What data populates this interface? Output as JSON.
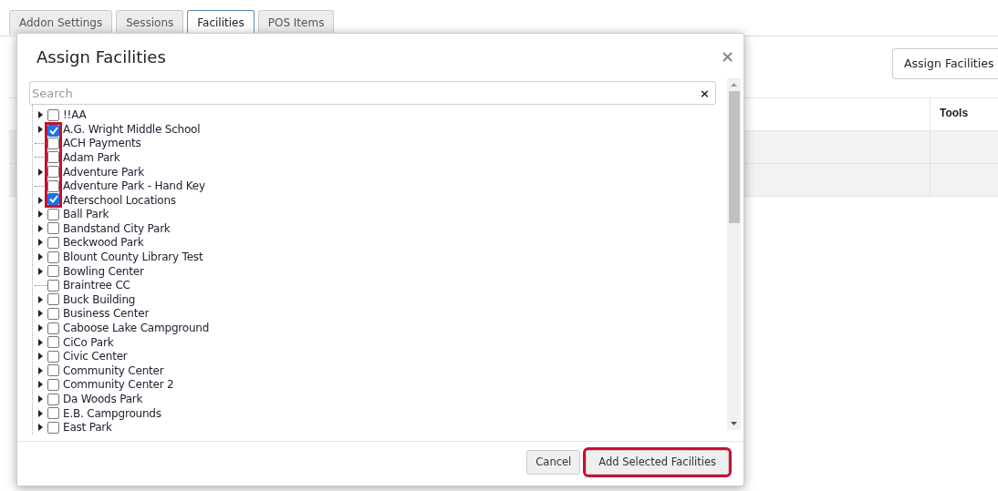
{
  "tabs": [
    {
      "label": "Addon Settings",
      "selected": false
    },
    {
      "label": "Sessions",
      "selected": false
    },
    {
      "label": "Facilities",
      "selected": true
    },
    {
      "label": "POS Items",
      "selected": false
    }
  ],
  "page": {
    "button": "Assign Facilities",
    "table": {
      "columns": [
        "Tools"
      ],
      "row_count_rows": [
        {
          "kind": "empty"
        },
        {
          "kind": "empty"
        }
      ]
    }
  },
  "dialog": {
    "title": "Assign Facilities",
    "close": "×",
    "search": {
      "placeholder": "Search",
      "clear": "×"
    },
    "items": [
      {
        "label": "!!AA",
        "expandable": true,
        "checked": false,
        "highlighted": false
      },
      {
        "label": "A.G. Wright Middle School",
        "expandable": true,
        "checked": true,
        "highlighted": true
      },
      {
        "label": "ACH Payments",
        "expandable": false,
        "checked": false,
        "highlighted": true
      },
      {
        "label": "Adam Park",
        "expandable": false,
        "checked": false,
        "highlighted": true
      },
      {
        "label": "Adventure Park",
        "expandable": true,
        "checked": false,
        "highlighted": true
      },
      {
        "label": "Adventure Park - Hand Key",
        "expandable": false,
        "checked": false,
        "highlighted": true
      },
      {
        "label": "Afterschool Locations",
        "expandable": true,
        "checked": true,
        "highlighted": true
      },
      {
        "label": "Ball Park",
        "expandable": true,
        "checked": false,
        "highlighted": false
      },
      {
        "label": "Bandstand City Park",
        "expandable": true,
        "checked": false,
        "highlighted": false
      },
      {
        "label": "Beckwood Park",
        "expandable": true,
        "checked": false,
        "highlighted": false
      },
      {
        "label": "Blount County Library Test",
        "expandable": true,
        "checked": false,
        "highlighted": false
      },
      {
        "label": "Bowling Center",
        "expandable": true,
        "checked": false,
        "highlighted": false
      },
      {
        "label": "Braintree CC",
        "expandable": false,
        "checked": false,
        "highlighted": false
      },
      {
        "label": "Buck Building",
        "expandable": true,
        "checked": false,
        "highlighted": false
      },
      {
        "label": "Business Center",
        "expandable": true,
        "checked": false,
        "highlighted": false
      },
      {
        "label": "Caboose Lake Campground",
        "expandable": true,
        "checked": false,
        "highlighted": false
      },
      {
        "label": "CiCo Park",
        "expandable": true,
        "checked": false,
        "highlighted": false
      },
      {
        "label": "Civic Center",
        "expandable": true,
        "checked": false,
        "highlighted": false
      },
      {
        "label": "Community Center",
        "expandable": true,
        "checked": false,
        "highlighted": false
      },
      {
        "label": "Community Center 2",
        "expandable": true,
        "checked": false,
        "highlighted": false
      },
      {
        "label": "Da Woods Park",
        "expandable": true,
        "checked": false,
        "highlighted": false
      },
      {
        "label": "E.B. Campgrounds",
        "expandable": true,
        "checked": false,
        "highlighted": false
      },
      {
        "label": "East Park",
        "expandable": true,
        "checked": false,
        "highlighted": false
      }
    ],
    "buttons": [
      {
        "label": "Cancel",
        "highlighted": false
      },
      {
        "label": "Add Selected Facilities",
        "highlighted": true
      }
    ]
  }
}
